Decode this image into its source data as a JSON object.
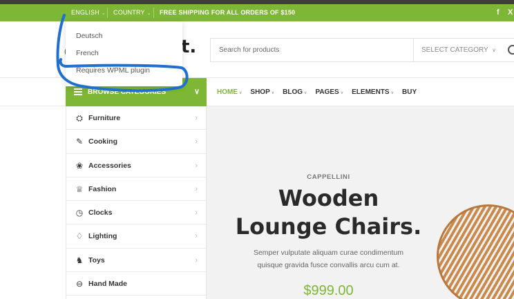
{
  "colors": {
    "accent": "#7eb636",
    "annotation": "#1f6fd1"
  },
  "topbar": {
    "language": "ENGLISH",
    "country": "COUNTRY",
    "shipping": "FREE SHIPPING FOR ALL ORDERS OF $150",
    "social": [
      "f",
      "X"
    ]
  },
  "language_dropdown": {
    "items": [
      "Deutsch",
      "French",
      "Requires WPML plugin"
    ]
  },
  "header": {
    "logo_fragment": "t.",
    "logo_left_fragment": "(",
    "search": {
      "placeholder": "Search for products",
      "category": "SELECT CATEGORY",
      "icon": "search-icon"
    }
  },
  "nav": {
    "browse": "BROWSE CATEGORIES",
    "items": [
      "HOME",
      "SHOP",
      "BLOG",
      "PAGES",
      "ELEMENTS",
      "BUY"
    ]
  },
  "categories": [
    {
      "label": "Furniture",
      "icon": "armchair-icon",
      "glyph": "⛭"
    },
    {
      "label": "Cooking",
      "icon": "cooking-icon",
      "glyph": "✎"
    },
    {
      "label": "Accessories",
      "icon": "accessories-icon",
      "glyph": "❀"
    },
    {
      "label": "Fashion",
      "icon": "fashion-icon",
      "glyph": "♕"
    },
    {
      "label": "Clocks",
      "icon": "clock-icon",
      "glyph": "◷"
    },
    {
      "label": "Lighting",
      "icon": "bulb-icon",
      "glyph": "♢"
    },
    {
      "label": "Toys",
      "icon": "toy-icon",
      "glyph": "♞"
    },
    {
      "label": "Hand Made",
      "icon": "handmade-icon",
      "glyph": "⊖"
    }
  ],
  "hero": {
    "brand": "CAPPELLINI",
    "title_line1": "Wooden",
    "title_line2": "Lounge Chairs.",
    "desc_line1": "Semper vulputate aliquam curae condimentum",
    "desc_line2": "quisque gravida fusce convallis arcu cum at.",
    "price": "$999.00"
  }
}
